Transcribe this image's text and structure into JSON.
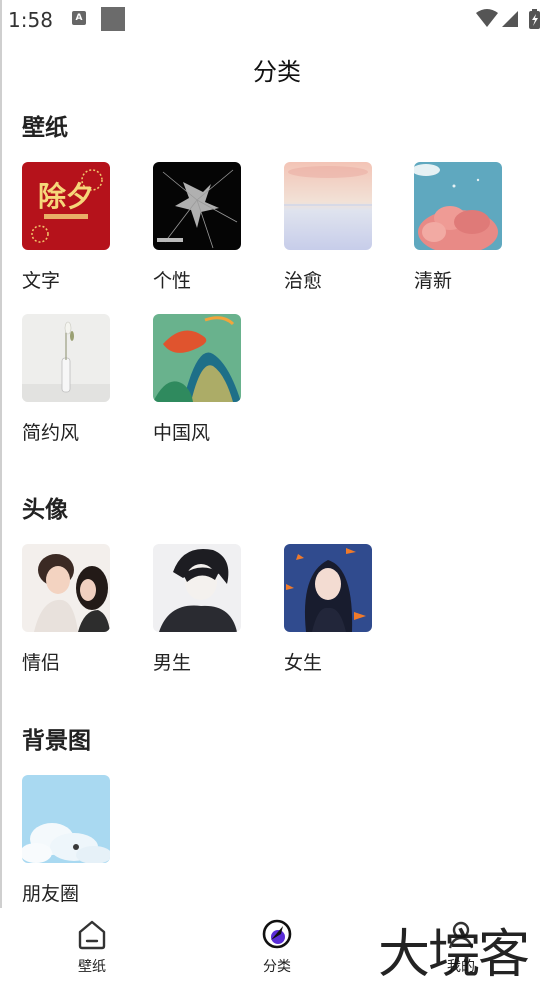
{
  "status_bar": {
    "time": "1:58",
    "notification_icon": "A"
  },
  "header": {
    "title": "分类"
  },
  "sections": [
    {
      "title": "壁纸",
      "items": [
        {
          "label": "文字",
          "image_text": "除夕"
        },
        {
          "label": "个性"
        },
        {
          "label": "治愈"
        },
        {
          "label": "清新"
        },
        {
          "label": "简约风"
        },
        {
          "label": "中国风"
        }
      ]
    },
    {
      "title": "头像",
      "items": [
        {
          "label": "情侣"
        },
        {
          "label": "男生"
        },
        {
          "label": "女生"
        }
      ]
    },
    {
      "title": "背景图",
      "items": [
        {
          "label": "朋友圈"
        }
      ]
    }
  ],
  "bottom_nav": {
    "items": [
      {
        "label": "壁纸",
        "icon": "home-icon"
      },
      {
        "label": "分类",
        "icon": "compass-icon",
        "active": true
      },
      {
        "label": "我的",
        "icon": "profile-icon"
      }
    ]
  },
  "watermark": "大垸客",
  "colors": {
    "active_accent": "#5a2dd8",
    "text": "#222222"
  }
}
